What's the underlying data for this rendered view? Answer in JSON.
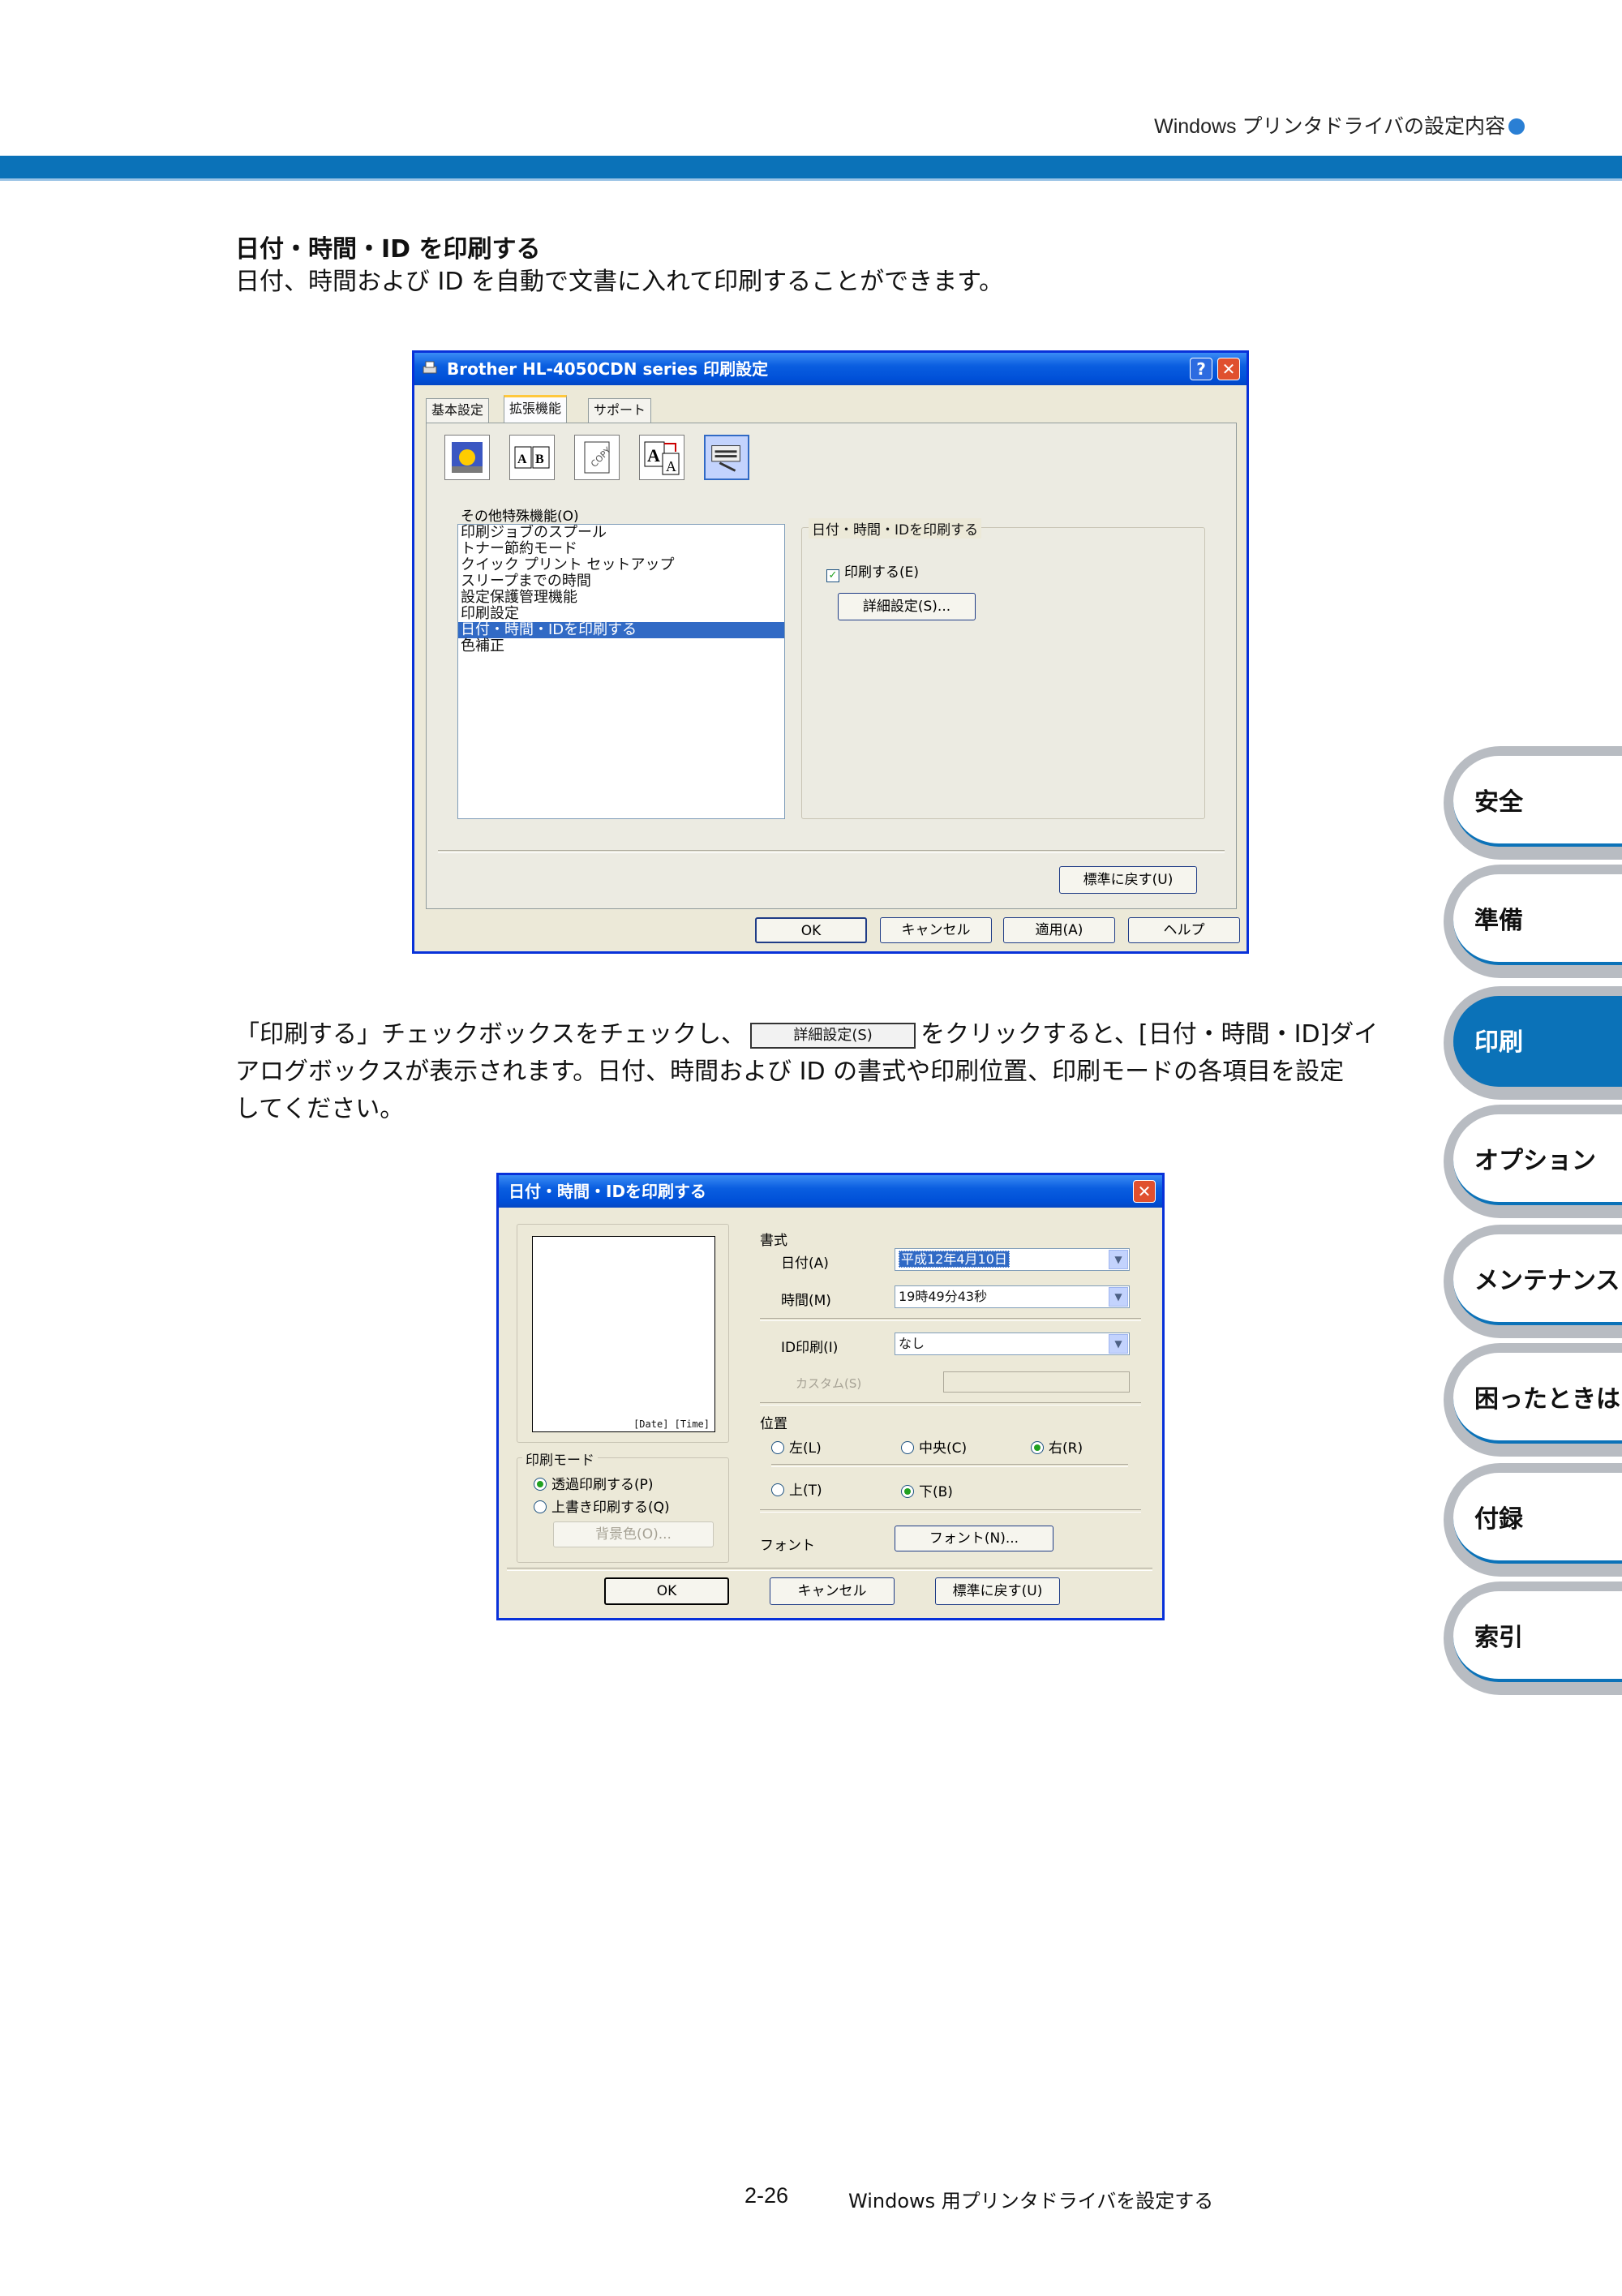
{
  "header": {
    "title": "Windows プリンタドライバの設定内容"
  },
  "section": {
    "title": "日付・時間・ID を印刷する",
    "intro": "日付、時間および ID を自動で文書に入れて印刷することができます。"
  },
  "dialog1": {
    "title": "Brother HL-4050CDN series 印刷設定",
    "tabs": [
      "基本設定",
      "拡張機能",
      "サポート"
    ],
    "list_label": "その他特殊機能(O)",
    "list_items": [
      "印刷ジョブのスプール",
      "トナー節約モード",
      "クイック プリント セットアップ",
      "スリープまでの時間",
      "設定保護管理機能",
      "印刷設定",
      "日付・時間・IDを印刷する",
      "色補正"
    ],
    "selected_index": 6,
    "group_title": "日付・時間・IDを印刷する",
    "print_checkbox": "印刷する(E)",
    "detail_button": "詳細設定(S)...",
    "restore_button": "標準に戻す(U)",
    "ok": "OK",
    "cancel": "キャンセル",
    "apply": "適用(A)",
    "help": "ヘルプ"
  },
  "instructions": {
    "line1_before": "「印刷する」チェックボックスをチェックし、",
    "inline_button": "詳細設定(S)",
    "line1_after": "をクリックすると、[日付・時間・ID]ダイ",
    "line2": "アログボックスが表示されます。日付、時間および ID の書式や印刷位置、印刷モードの各項目を設定",
    "line3": "してください。"
  },
  "dialog2": {
    "title": "日付・時間・IDを印刷する",
    "preview_text": "[Date] [Time]",
    "format_label": "書式",
    "date_label": "日付(A)",
    "date_value": "平成12年4月10日",
    "time_label": "時間(M)",
    "time_value": "19時49分43秒",
    "id_label": "ID印刷(I)",
    "id_value": "なし",
    "custom_label": "カスタム(S)",
    "print_mode_label": "印刷モード",
    "mode_transparent": "透過印刷する(P)",
    "mode_overwrite": "上書き印刷する(Q)",
    "bg_color_button": "背景色(O)...",
    "position_label": "位置",
    "pos_left": "左(L)",
    "pos_center": "中央(C)",
    "pos_right": "右(R)",
    "pos_top": "上(T)",
    "pos_bottom": "下(B)",
    "font_label": "フォント",
    "font_button": "フォント(N)...",
    "ok": "OK",
    "cancel": "キャンセル",
    "restore": "標準に戻す(U)"
  },
  "side_tabs": [
    "安全",
    "準備",
    "印刷",
    "オプション",
    "メンテナンス",
    "困ったときは",
    "付録",
    "索引"
  ],
  "active_side_tab": "印刷",
  "footer": {
    "page": "2-26",
    "title": "Windows 用プリンタドライバを設定する"
  },
  "colors": {
    "accent": "#0b72b8",
    "xp_title": "#0050d8",
    "selection": "#316ac5"
  }
}
